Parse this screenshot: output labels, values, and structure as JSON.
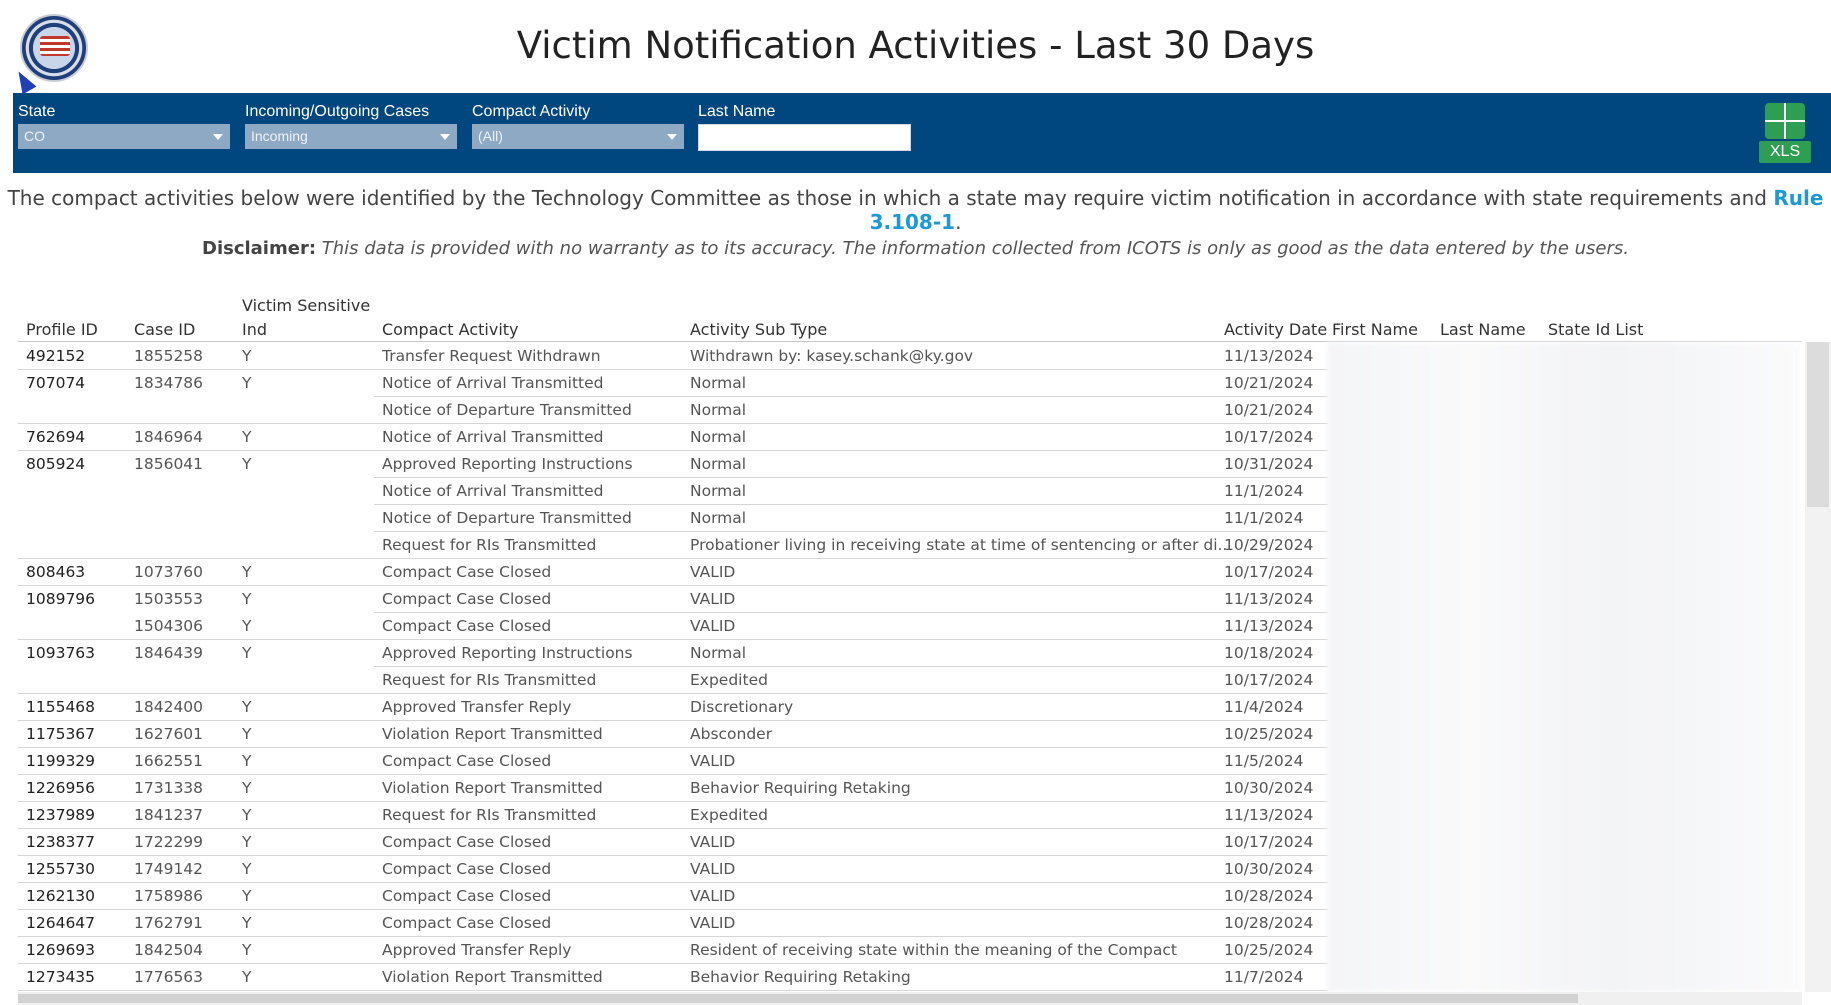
{
  "title": "Victim Notification Activities - Last 30 Days",
  "filters": {
    "state": {
      "label": "State",
      "value": "CO"
    },
    "direction": {
      "label": "Incoming/Outgoing Cases",
      "value": "Incoming"
    },
    "activity": {
      "label": "Compact Activity",
      "value": "(All)"
    },
    "last_name": {
      "label": "Last Name",
      "value": ""
    }
  },
  "export": {
    "label": "XLS",
    "icon": "excel-export-icon",
    "color": "#2e9e52"
  },
  "info": {
    "text": "The compact activities below were identified by the Technology Committee as those in which a state may require victim notification in accordance with state requirements and ",
    "link": "Rule 3.108-1",
    "end": "."
  },
  "disclaimer": {
    "label": "Disclaimer:",
    "text": " This data is provided with no warranty as to its accuracy. The information collected from ICOTS is only as good as the data entered by the users."
  },
  "columns": {
    "profile_id": "Profile ID",
    "case_id": "Case ID",
    "victim_line1": "Victim Sensitive",
    "victim_line2": "Ind",
    "compact_activity": "Compact Activity",
    "sub_type": "Activity Sub Type",
    "date": "Activity Date",
    "first_name": "First Name",
    "last_name": "Last Name",
    "state_id": "State Id List"
  },
  "rows": [
    {
      "profile_id": "492152",
      "case_id": "1855258",
      "vs": "Y",
      "activity": "Transfer Request Withdrawn",
      "sub_type": "Withdrawn by: kasey.schank@ky.gov",
      "date": "11/13/2024"
    },
    {
      "profile_id": "707074",
      "case_id": "1834786",
      "vs": "Y",
      "activity": "Notice of Arrival Transmitted",
      "sub_type": "Normal",
      "date": "10/21/2024"
    },
    {
      "profile_id": "",
      "case_id": "",
      "vs": "",
      "activity": "Notice of Departure Transmitted",
      "sub_type": "Normal",
      "date": "10/21/2024"
    },
    {
      "profile_id": "762694",
      "case_id": "1846964",
      "vs": "Y",
      "activity": "Notice of Arrival Transmitted",
      "sub_type": "Normal",
      "date": "10/17/2024"
    },
    {
      "profile_id": "805924",
      "case_id": "1856041",
      "vs": "Y",
      "activity": "Approved Reporting Instructions",
      "sub_type": "Normal",
      "date": "10/31/2024"
    },
    {
      "profile_id": "",
      "case_id": "",
      "vs": "",
      "activity": "Notice of Arrival Transmitted",
      "sub_type": "Normal",
      "date": "11/1/2024"
    },
    {
      "profile_id": "",
      "case_id": "",
      "vs": "",
      "activity": "Notice of Departure Transmitted",
      "sub_type": "Normal",
      "date": "11/1/2024"
    },
    {
      "profile_id": "",
      "case_id": "",
      "vs": "",
      "activity": "Request for RIs Transmitted",
      "sub_type": "Probationer living in receiving state at time of sentencing or after di..",
      "date": "10/29/2024"
    },
    {
      "profile_id": "808463",
      "case_id": "1073760",
      "vs": "Y",
      "activity": "Compact Case Closed",
      "sub_type": "VALID",
      "date": "10/17/2024"
    },
    {
      "profile_id": "1089796",
      "case_id": "1503553",
      "vs": "Y",
      "activity": "Compact Case Closed",
      "sub_type": "VALID",
      "date": "11/13/2024"
    },
    {
      "profile_id": "",
      "case_id": "1504306",
      "vs": "Y",
      "activity": "Compact Case Closed",
      "sub_type": "VALID",
      "date": "11/13/2024"
    },
    {
      "profile_id": "1093763",
      "case_id": "1846439",
      "vs": "Y",
      "activity": "Approved Reporting Instructions",
      "sub_type": "Normal",
      "date": "10/18/2024"
    },
    {
      "profile_id": "",
      "case_id": "",
      "vs": "",
      "activity": "Request for RIs Transmitted",
      "sub_type": "Expedited",
      "date": "10/17/2024"
    },
    {
      "profile_id": "1155468",
      "case_id": "1842400",
      "vs": "Y",
      "activity": "Approved Transfer Reply",
      "sub_type": "Discretionary",
      "date": "11/4/2024"
    },
    {
      "profile_id": "1175367",
      "case_id": "1627601",
      "vs": "Y",
      "activity": "Violation Report Transmitted",
      "sub_type": "Absconder",
      "date": "10/25/2024"
    },
    {
      "profile_id": "1199329",
      "case_id": "1662551",
      "vs": "Y",
      "activity": "Compact Case Closed",
      "sub_type": "VALID",
      "date": "11/5/2024"
    },
    {
      "profile_id": "1226956",
      "case_id": "1731338",
      "vs": "Y",
      "activity": "Violation Report Transmitted",
      "sub_type": "Behavior Requiring Retaking",
      "date": "10/30/2024"
    },
    {
      "profile_id": "1237989",
      "case_id": "1841237",
      "vs": "Y",
      "activity": "Request for RIs Transmitted",
      "sub_type": "Expedited",
      "date": "11/13/2024"
    },
    {
      "profile_id": "1238377",
      "case_id": "1722299",
      "vs": "Y",
      "activity": "Compact Case Closed",
      "sub_type": "VALID",
      "date": "10/17/2024"
    },
    {
      "profile_id": "1255730",
      "case_id": "1749142",
      "vs": "Y",
      "activity": "Compact Case Closed",
      "sub_type": "VALID",
      "date": "10/30/2024"
    },
    {
      "profile_id": "1262130",
      "case_id": "1758986",
      "vs": "Y",
      "activity": "Compact Case Closed",
      "sub_type": "VALID",
      "date": "10/28/2024"
    },
    {
      "profile_id": "1264647",
      "case_id": "1762791",
      "vs": "Y",
      "activity": "Compact Case Closed",
      "sub_type": "VALID",
      "date": "10/28/2024"
    },
    {
      "profile_id": "1269693",
      "case_id": "1842504",
      "vs": "Y",
      "activity": "Approved Transfer Reply",
      "sub_type": "Resident of receiving state within the meaning of the Compact",
      "date": "10/25/2024"
    },
    {
      "profile_id": "1273435",
      "case_id": "1776563",
      "vs": "Y",
      "activity": "Violation Report Transmitted",
      "sub_type": "Behavior Requiring Retaking",
      "date": "11/7/2024"
    }
  ]
}
